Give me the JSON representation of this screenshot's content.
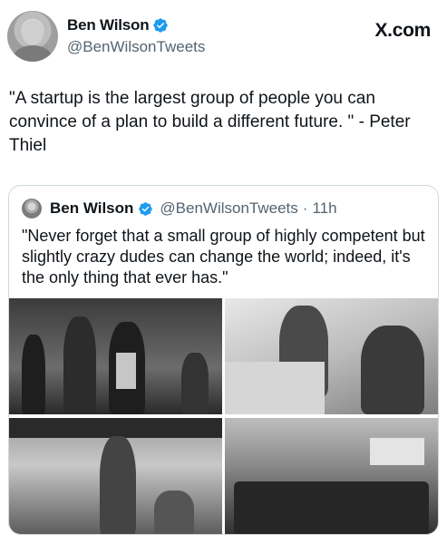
{
  "author": {
    "display_name": "Ben Wilson",
    "handle": "@BenWilsonTweets",
    "verified_icon": "verified-badge-icon"
  },
  "brand": "X.com",
  "tweet": {
    "text": "\"A startup is the largest group of people you can convince of a plan to build a different future. \" - Peter Thiel"
  },
  "quoted": {
    "display_name": "Ben Wilson",
    "handle": "@BenWilsonTweets",
    "separator": "·",
    "time": "11h",
    "text": "\"Never forget that a small group of highly competent but slightly crazy dudes can change the world; indeed, it's the only thing that ever has.\""
  },
  "colors": {
    "verified": "#1d9bf0",
    "secondary_text": "#536471",
    "border": "#cfd9de"
  }
}
